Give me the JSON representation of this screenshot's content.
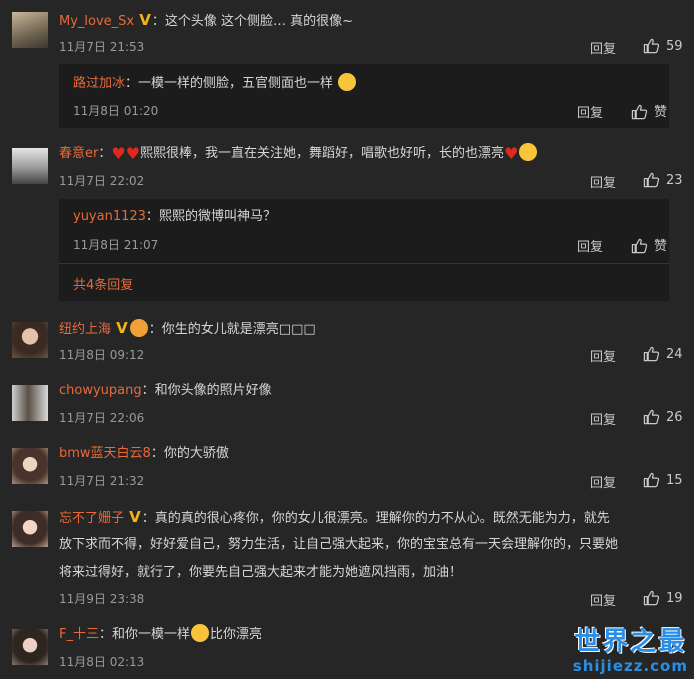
{
  "comments": [
    {
      "name": "My_love_Sx",
      "text": "这个头像 这个侧脸… 真的很像~",
      "time": "11月7日 21:53",
      "reply": "回复",
      "likes": "59"
    },
    {
      "name": "春意er",
      "text": "熙熙很棒，我一直在关注她，舞蹈好，唱歌也好听，长的也漂亮",
      "time": "11月7日 22:02",
      "reply": "回复",
      "likes": "23"
    },
    {
      "name": "纽约上海",
      "text": "你生的女儿就是漂亮□□□",
      "time": "11月8日 09:12",
      "reply": "回复",
      "likes": "24"
    },
    {
      "name": "chowyupang",
      "text": "和你头像的照片好像",
      "time": "11月7日 22:06",
      "reply": "回复",
      "likes": "26"
    },
    {
      "name": "bmw蓝天白云8",
      "text": "你的大骄傲",
      "time": "11月7日 21:32",
      "reply": "回复",
      "likes": "15"
    },
    {
      "name": "忘不了姗子",
      "text_l1": "真的真的很心疼你，你的女儿很漂亮。理解你的力不从心。既然无能为力，就先",
      "text_l2": "放下求而不得，好好爱自己，努力生活，让自己强大起来，你的宝宝总有一天会理解你的，只要她",
      "text_l3": "将来过得好，就行了，你要先自己强大起来才能为她遮风挡雨，加油！",
      "time": "11月9日 23:38",
      "reply": "回复",
      "likes": "19"
    },
    {
      "name": "F_十三",
      "text_a": "和你一模一样",
      "text_b": "比你漂亮",
      "time": "11月8日 02:13"
    }
  ],
  "subreplies": [
    {
      "name": "路过加冰",
      "text": "一模一样的侧脸，五官侧面也一样",
      "time": "11月8日 01:20",
      "reply": "回复",
      "like_label": "赞"
    },
    {
      "name": "yuyan1123",
      "text": "熙熙的微博叫神马？",
      "time": "11月8日 21:07",
      "reply": "回复",
      "like_label": "赞"
    }
  ],
  "more_replies": "共4条回复",
  "sep": "：",
  "vbadge": "V",
  "watermark": {
    "title": "世界之最",
    "sub": "shijiezz.com"
  },
  "colors": {
    "background": "#262626",
    "name": "#e86a3a",
    "subbox": "#1c1c1c",
    "watermark": "#2a8ee6"
  }
}
